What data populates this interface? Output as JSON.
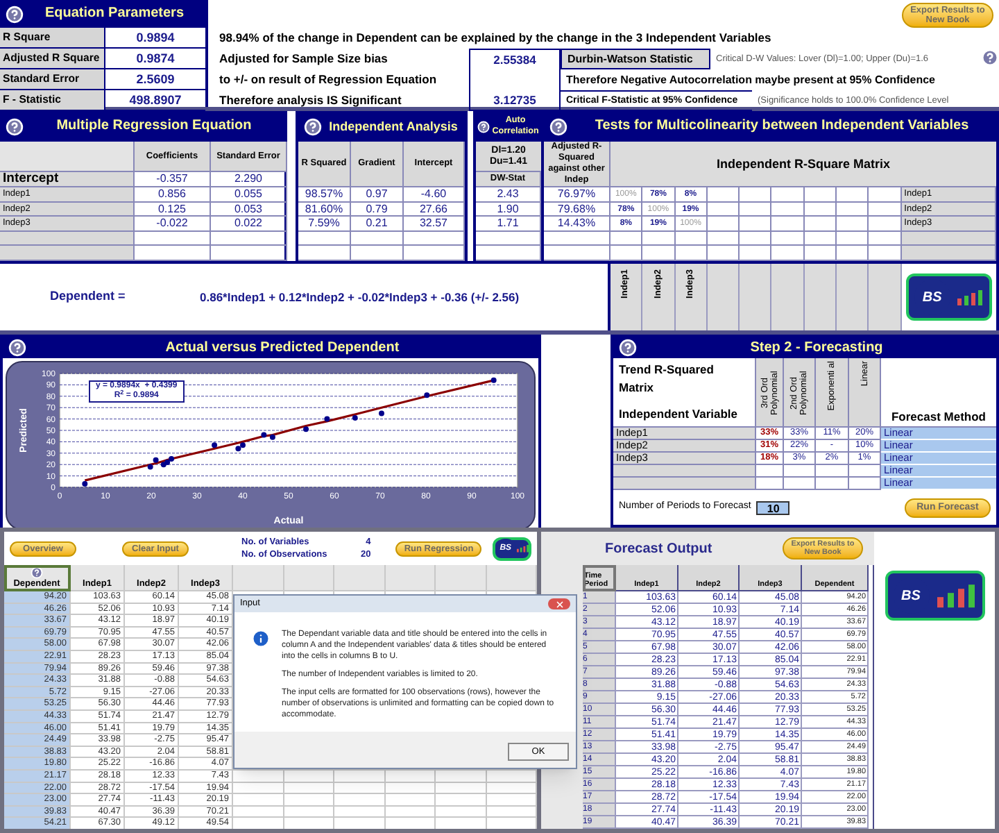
{
  "equation_parameters": {
    "title": "Equation Parameters",
    "stats": [
      {
        "label": "R Square",
        "value": "0.9894"
      },
      {
        "label": "Adjusted R Square",
        "value": "0.9874"
      },
      {
        "label": "Standard Error",
        "value": "2.5609"
      },
      {
        "label": "F - Statistic",
        "value": "498.8907"
      }
    ],
    "summary": "98.94% of the change in Dependent can be explained by the change in the 3 Independent Variables",
    "notes": [
      "Adjusted for Sample Size bias",
      "to +/- on result of Regression Equation",
      "Therefore analysis IS Significant"
    ],
    "export_button": "Export Results to New Book"
  },
  "durbin_watson": {
    "value": "2.55384",
    "label": "Durbin-Watson Statistic",
    "critical": "Critical D-W Values: Lover (Dl)=1.00; Upper (Du)=1.6",
    "conclusion": "Therefore Negative Autocorrelation maybe present at 95% Confidence"
  },
  "f_test": {
    "value": "3.12735",
    "label": "Critical F-Statistic at 95% Confidence",
    "note": "(Significance holds to 100.0% Confidence Level"
  },
  "regression": {
    "title": "Multiple Regression Equation",
    "columns": [
      "Coefficients",
      "Standard Error"
    ],
    "rows": [
      {
        "label": "Intercept",
        "values": [
          "-0.357",
          "2.290"
        ]
      },
      {
        "label": "Indep1",
        "values": [
          "0.856",
          "0.055"
        ]
      },
      {
        "label": "Indep2",
        "values": [
          "0.125",
          "0.053"
        ]
      },
      {
        "label": "Indep3",
        "values": [
          "-0.022",
          "0.022"
        ]
      }
    ],
    "equation_label": "Dependent =",
    "equation": "0.86*Indep1 + 0.12*Indep2 + -0.02*Indep3 + -0.36 (+/- 2.56)"
  },
  "independent_analysis": {
    "title": "Independent Analysis",
    "columns": [
      "R Squared",
      "Gradient",
      "Intercept"
    ],
    "rows": [
      [
        "98.57%",
        "0.97",
        "-4.60"
      ],
      [
        "81.60%",
        "0.79",
        "27.66"
      ],
      [
        "7.59%",
        "0.21",
        "32.57"
      ]
    ]
  },
  "auto_correlation": {
    "title": "Auto Correlation",
    "dl": "Dl=1.20",
    "du": "Du=1.41",
    "column": "DW-Stat",
    "values": [
      "2.43",
      "1.90",
      "1.71"
    ]
  },
  "multicolinearity": {
    "title": "Tests for Multicolinearity between Independent Variables",
    "adjusted_column": "Adjusted R-Squared against other Indep",
    "adjusted_values": [
      "76.97%",
      "79.68%",
      "14.43%"
    ],
    "matrix_title": "Independent R-Square Matrix",
    "matrix": [
      [
        "100%",
        "78%",
        "8%"
      ],
      [
        "78%",
        "100%",
        "19%"
      ],
      [
        "8%",
        "19%",
        "100%"
      ]
    ],
    "row_labels": [
      "Indep1",
      "Indep2",
      "Indep3"
    ],
    "column_labels": [
      "Indep1",
      "Indep2",
      "Indep3"
    ],
    "logo": "BS"
  },
  "chart_panel": {
    "title": "Actual versus Predicted Dependent",
    "chart_data": {
      "type": "scatter",
      "xlabel": "Actual",
      "ylabel": "Predicted",
      "x": [
        5.5,
        19.8,
        21,
        22.7,
        23.5,
        24.4,
        33.8,
        39,
        40,
        44.6,
        46.5,
        53.8,
        58.4,
        64.5,
        70.3,
        80.2,
        94.8
      ],
      "series": [
        {
          "color": "#00008b",
          "values": [
            3,
            18,
            24,
            20,
            22,
            25,
            37,
            34,
            37,
            46,
            44,
            51,
            60,
            61,
            65,
            81,
            94
          ]
        },
        {
          "type": "line",
          "color": "#8b0000",
          "values": [
            6,
            20,
            21,
            23,
            24,
            25,
            34,
            39,
            40,
            45,
            46,
            54,
            58,
            64,
            70,
            80,
            94
          ]
        }
      ],
      "grid": true,
      "xlim": [
        0,
        100
      ],
      "ylim": [
        0,
        100
      ],
      "xticks": [
        0,
        10,
        20,
        30,
        40,
        50,
        60,
        70,
        80,
        90,
        100
      ],
      "yticks": [
        0,
        10,
        20,
        30,
        40,
        50,
        60,
        70,
        80,
        90,
        100
      ],
      "annotations": [
        "y = 0.9894x  + 0.4399",
        "R$^{2}$ = 0.9894"
      ]
    }
  },
  "forecasting": {
    "title": "Step 2 - Forecasting",
    "matrix_title": "Trend R-Squared Matrix",
    "variable_header": "Independent Variable",
    "columns": [
      "3rd Ord Polynomial",
      "2nd Ord Polynomial",
      "Exponenti al",
      "Linear"
    ],
    "method_header": "Forecast Method",
    "rows": [
      {
        "label": "Indep1",
        "values": [
          {
            "text": "33%",
            "best": true
          },
          {
            "text": "33%",
            "best": false
          },
          {
            "text": "11%",
            "best": false
          },
          {
            "text": "20%",
            "best": false
          }
        ],
        "method": "Linear"
      },
      {
        "label": "Indep2",
        "values": [
          {
            "text": "31%",
            "best": true
          },
          {
            "text": "22%",
            "best": false
          },
          {
            "text": "-",
            "best": false
          },
          {
            "text": "10%",
            "best": false
          }
        ],
        "method": "Linear"
      },
      {
        "label": "Indep3",
        "values": [
          {
            "text": "18%",
            "best": true
          },
          {
            "text": "3%",
            "best": false
          },
          {
            "text": "2%",
            "best": false
          },
          {
            "text": "1%",
            "best": false
          }
        ],
        "method": "Linear"
      },
      {
        "method": "Linear"
      },
      {
        "method": "Linear"
      }
    ],
    "periods_label": "Number of Periods to Forecast",
    "periods_value": "10",
    "run_button": "Run Forecast"
  },
  "input_sheet": {
    "overview_button": "Overview",
    "clear_button": "Clear Input",
    "run_button": "Run Regression",
    "counts": [
      {
        "label": "No. of Variables",
        "value": "4"
      },
      {
        "label": "No. of Observations",
        "value": "20"
      }
    ],
    "logo": "BS",
    "columns": [
      "Dependent",
      "Indep1",
      "Indep2",
      "Indep3"
    ],
    "rows": [
      [
        "94.20",
        "103.63",
        "60.14",
        "45.08"
      ],
      [
        "46.26",
        "52.06",
        "10.93",
        "7.14"
      ],
      [
        "33.67",
        "43.12",
        "18.97",
        "40.19"
      ],
      [
        "69.79",
        "70.95",
        "47.55",
        "40.57"
      ],
      [
        "58.00",
        "67.98",
        "30.07",
        "42.06"
      ],
      [
        "22.91",
        "28.23",
        "17.13",
        "85.04"
      ],
      [
        "79.94",
        "89.26",
        "59.46",
        "97.38"
      ],
      [
        "24.33",
        "31.88",
        "-0.88",
        "54.63"
      ],
      [
        "5.72",
        "9.15",
        "-27.06",
        "20.33"
      ],
      [
        "53.25",
        "56.30",
        "44.46",
        "77.93"
      ],
      [
        "44.33",
        "51.74",
        "21.47",
        "12.79"
      ],
      [
        "46.00",
        "51.41",
        "19.79",
        "14.35"
      ],
      [
        "24.49",
        "33.98",
        "-2.75",
        "95.47"
      ],
      [
        "38.83",
        "43.20",
        "2.04",
        "58.81"
      ],
      [
        "19.80",
        "25.22",
        "-16.86",
        "4.07"
      ],
      [
        "21.17",
        "28.18",
        "12.33",
        "7.43"
      ],
      [
        "22.00",
        "28.72",
        "-17.54",
        "19.94"
      ],
      [
        "23.00",
        "27.74",
        "-11.43",
        "20.19"
      ],
      [
        "39.83",
        "40.47",
        "36.39",
        "70.21"
      ],
      [
        "54.21",
        "67.30",
        "49.12",
        "49.54"
      ]
    ]
  },
  "dialog": {
    "title": "Input",
    "paragraphs": [
      "The Dependant variable data and title should be entered into the cells in column A and the Independent variables' data & titles should be entered into the cells in columns B to U.",
      "The number of Independent variables is limited to 20.",
      "The input cells are formatted for 100 observations (rows), however the number of observations is unlimited and formatting can be copied down to accommodate."
    ],
    "ok_button": "OK"
  },
  "forecast_output": {
    "title": "Forecast Output",
    "export_button": "Export Results to New Book",
    "logo": "BS",
    "columns": [
      "Time Period",
      "Indep1",
      "Indep2",
      "Indep3",
      "Dependent"
    ],
    "rows": [
      [
        "1",
        "103.63",
        "60.14",
        "45.08",
        "94.20"
      ],
      [
        "2",
        "52.06",
        "10.93",
        "7.14",
        "46.26"
      ],
      [
        "3",
        "43.12",
        "18.97",
        "40.19",
        "33.67"
      ],
      [
        "4",
        "70.95",
        "47.55",
        "40.57",
        "69.79"
      ],
      [
        "5",
        "67.98",
        "30.07",
        "42.06",
        "58.00"
      ],
      [
        "6",
        "28.23",
        "17.13",
        "85.04",
        "22.91"
      ],
      [
        "7",
        "89.26",
        "59.46",
        "97.38",
        "79.94"
      ],
      [
        "8",
        "31.88",
        "-0.88",
        "54.63",
        "24.33"
      ],
      [
        "9",
        "9.15",
        "-27.06",
        "20.33",
        "5.72"
      ],
      [
        "10",
        "56.30",
        "44.46",
        "77.93",
        "53.25"
      ],
      [
        "11",
        "51.74",
        "21.47",
        "12.79",
        "44.33"
      ],
      [
        "12",
        "51.41",
        "19.79",
        "14.35",
        "46.00"
      ],
      [
        "13",
        "33.98",
        "-2.75",
        "95.47",
        "24.49"
      ],
      [
        "14",
        "43.20",
        "2.04",
        "58.81",
        "38.83"
      ],
      [
        "15",
        "25.22",
        "-16.86",
        "4.07",
        "19.80"
      ],
      [
        "16",
        "28.18",
        "12.33",
        "7.43",
        "21.17"
      ],
      [
        "17",
        "28.72",
        "-17.54",
        "19.94",
        "22.00"
      ],
      [
        "18",
        "27.74",
        "-11.43",
        "20.19",
        "23.00"
      ],
      [
        "19",
        "40.47",
        "36.39",
        "70.21",
        "39.83"
      ]
    ]
  }
}
